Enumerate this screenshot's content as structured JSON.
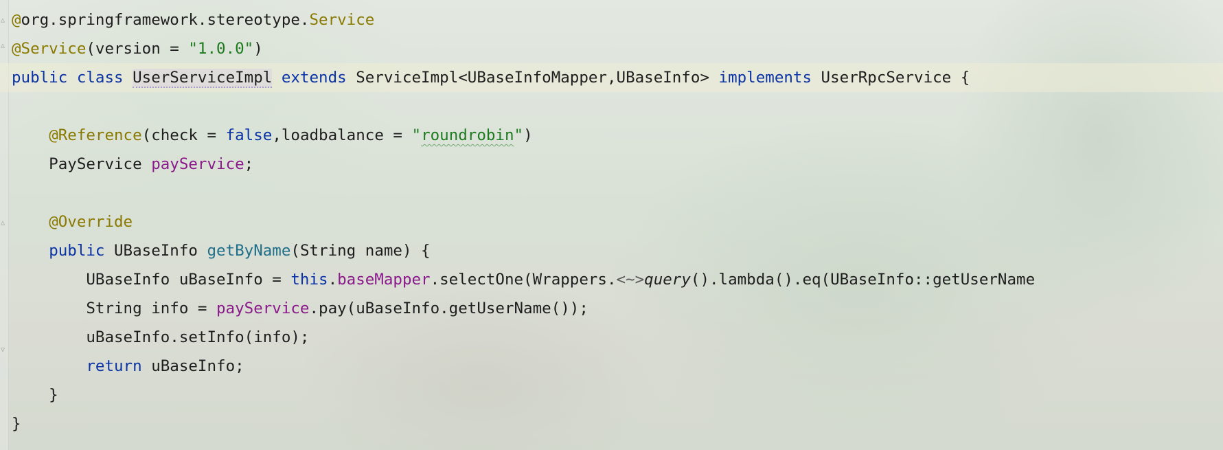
{
  "editor": {
    "lines": [
      [
        {
          "c": "ann",
          "t": "@"
        },
        {
          "c": "",
          "t": "org.springframework.stereotype."
        },
        {
          "c": "ann",
          "t": "Service"
        }
      ],
      [
        {
          "c": "ann",
          "t": "@Service"
        },
        {
          "c": "",
          "t": "(version = "
        },
        {
          "c": "str",
          "t": "\"1.0.0\""
        },
        {
          "c": "",
          "t": ")"
        }
      ],
      [
        {
          "c": "kw",
          "t": "public class "
        },
        {
          "c": "hl-class",
          "t": "UserServiceImpl"
        },
        {
          "c": "",
          "t": " "
        },
        {
          "c": "kw",
          "t": "extends"
        },
        {
          "c": "",
          "t": " ServiceImpl<UBaseInfoMapper,UBaseInfo> "
        },
        {
          "c": "kw",
          "t": "implements"
        },
        {
          "c": "",
          "t": " UserRpcService {"
        }
      ],
      [
        {
          "c": "",
          "t": ""
        }
      ],
      [
        {
          "c": "",
          "t": "    "
        },
        {
          "c": "ann",
          "t": "@Reference"
        },
        {
          "c": "",
          "t": "(check = "
        },
        {
          "c": "kw",
          "t": "false"
        },
        {
          "c": "",
          "t": ",loadbalance = "
        },
        {
          "c": "str",
          "t": "\""
        },
        {
          "c": "str typo",
          "t": "roundrobin"
        },
        {
          "c": "str",
          "t": "\""
        },
        {
          "c": "",
          "t": ")"
        }
      ],
      [
        {
          "c": "",
          "t": "    PayService "
        },
        {
          "c": "fld",
          "t": "payService"
        },
        {
          "c": "",
          "t": ";"
        }
      ],
      [
        {
          "c": "",
          "t": ""
        }
      ],
      [
        {
          "c": "",
          "t": "    "
        },
        {
          "c": "ann",
          "t": "@Override"
        }
      ],
      [
        {
          "c": "",
          "t": "    "
        },
        {
          "c": "kw",
          "t": "public"
        },
        {
          "c": "",
          "t": " UBaseInfo "
        },
        {
          "c": "fn",
          "t": "getByName"
        },
        {
          "c": "",
          "t": "(String name) {"
        }
      ],
      [
        {
          "c": "",
          "t": "        UBaseInfo uBaseInfo = "
        },
        {
          "c": "kw",
          "t": "this"
        },
        {
          "c": "",
          "t": "."
        },
        {
          "c": "fld",
          "t": "baseMapper"
        },
        {
          "c": "",
          "t": ".selectOne(Wrappers."
        },
        {
          "c": "gen",
          "t": "<~>"
        },
        {
          "c": "it",
          "t": "query"
        },
        {
          "c": "",
          "t": "().lambda().eq(UBaseInfo::getUserName"
        }
      ],
      [
        {
          "c": "",
          "t": "        String info = "
        },
        {
          "c": "fld",
          "t": "payService"
        },
        {
          "c": "",
          "t": ".pay(uBaseInfo.getUserName());"
        }
      ],
      [
        {
          "c": "",
          "t": "        uBaseInfo.setInfo(info);"
        }
      ],
      [
        {
          "c": "",
          "t": "        "
        },
        {
          "c": "kw",
          "t": "return"
        },
        {
          "c": "",
          "t": " uBaseInfo;"
        }
      ],
      [
        {
          "c": "",
          "t": "    }"
        }
      ],
      [
        {
          "c": "",
          "t": "}"
        }
      ]
    ]
  }
}
